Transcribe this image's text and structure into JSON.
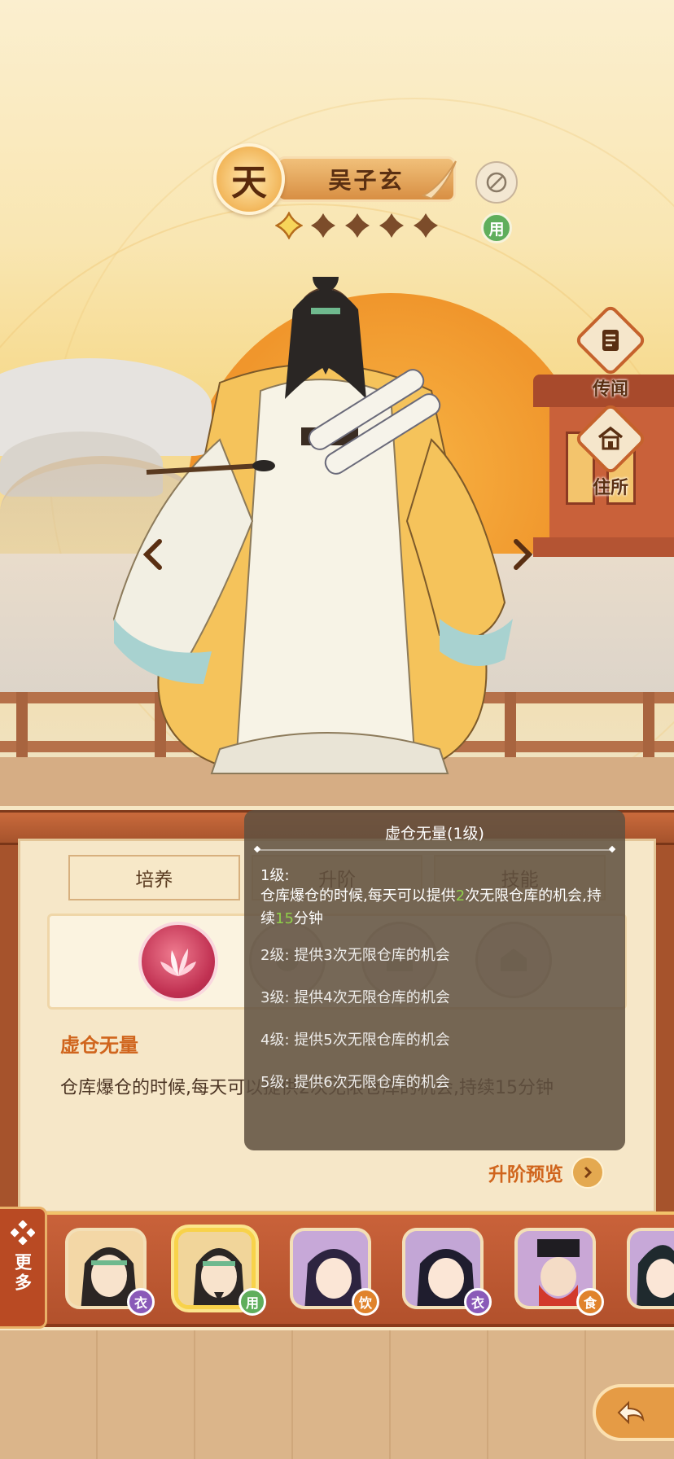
{
  "header": {
    "grade": "天",
    "name": "吴子玄",
    "used_badge": "用",
    "star_count": 5,
    "edit_icon": "brush-circle-icon"
  },
  "side_buttons": [
    {
      "label": "传闻",
      "icon": "scroll-icon"
    },
    {
      "label": "住所",
      "icon": "house-icon"
    }
  ],
  "tabs": [
    {
      "label": "培养"
    },
    {
      "label": "升阶"
    },
    {
      "label": "技能"
    }
  ],
  "skill": {
    "title": "虚仓无量",
    "description": "仓库爆仓的时候,每天可以提供2次无限仓库的机会,持续15分钟"
  },
  "preview": {
    "label": "升阶预览"
  },
  "tooltip": {
    "title": "虚仓无量(1级)",
    "level1_label": "1级:",
    "level1_desc_prefix": "仓库爆仓的时候,每天可以提供",
    "level1_times": "2",
    "level1_desc_mid": "次无限仓库的机会,持续",
    "level1_minutes": "15",
    "level1_desc_suffix": "分钟",
    "levels": [
      "2级: 提供3次无限仓库的机会",
      "3级: 提供4次无限仓库的机会",
      "4级: 提供5次无限仓库的机会",
      "5级: 提供6次无限仓库的机会"
    ]
  },
  "roster": {
    "more_label": "更多",
    "characters": [
      {
        "badge": "衣",
        "badge_color": "#8a5ab8"
      },
      {
        "badge": "用",
        "badge_color": "#5fae5c"
      },
      {
        "badge": "饮",
        "badge_color": "#e0832c"
      },
      {
        "badge": "衣",
        "badge_color": "#8a5ab8"
      },
      {
        "badge": "食",
        "badge_color": "#e0832c"
      }
    ]
  },
  "colors": {
    "accent_orange": "#d0651d",
    "panel_red": "#a6532c",
    "highlight_green": "#8fd04a"
  }
}
